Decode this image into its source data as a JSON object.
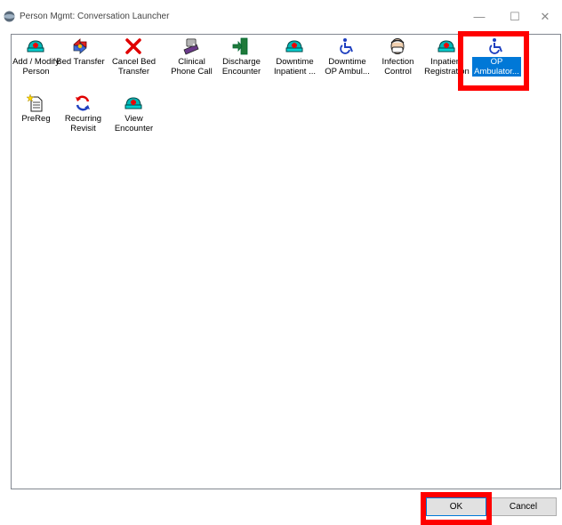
{
  "window": {
    "title": "Person Mgmt: Conversation Launcher",
    "controls": {
      "minimize": "—",
      "maximize": "☐",
      "close": "✕"
    }
  },
  "launcher": {
    "items": [
      {
        "label": "Add / Modify\nPerson",
        "icon": "nurse-cap-icon"
      },
      {
        "label": "Bed Transfer",
        "icon": "bed-transfer-icon"
      },
      {
        "label": "Cancel Bed\nTransfer",
        "icon": "red-x-icon"
      },
      {
        "label": "Clinical\nPhone Call",
        "icon": "phone-icon"
      },
      {
        "label": "Discharge\nEncounter",
        "icon": "discharge-door-icon"
      },
      {
        "label": "Downtime\nInpatient ...",
        "icon": "nurse-cap-icon"
      },
      {
        "label": "Downtime\nOP Ambul...",
        "icon": "wheelchair-icon"
      },
      {
        "label": "Infection\nControl",
        "icon": "infection-mask-icon"
      },
      {
        "label": "Inpatient\nRegistration",
        "icon": "nurse-cap-icon"
      },
      {
        "label": "OP\nAmbulator...",
        "icon": "wheelchair-icon",
        "selected": true
      },
      {
        "label": "PreReg",
        "icon": "new-document-icon"
      },
      {
        "label": "Recurring\nRevisit",
        "icon": "recurring-arrows-icon"
      },
      {
        "label": "View\nEncounter",
        "icon": "nurse-cap-icon"
      }
    ]
  },
  "buttons": {
    "ok": "OK",
    "cancel": "Cancel"
  },
  "colors": {
    "selection": "#0078d7",
    "highlight": "#ff0000"
  }
}
